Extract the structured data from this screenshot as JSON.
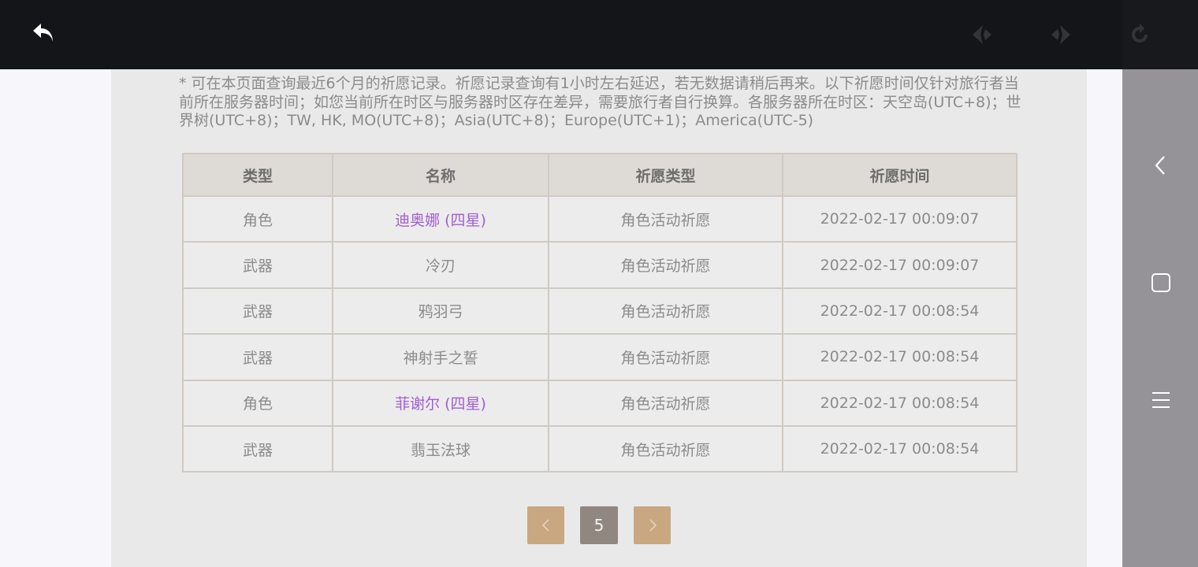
{
  "notice": "* 可在本页面查询最近6个月的祈愿记录。祈愿记录查询有1小时左右延迟，若无数据请稍后再来。以下祈愿时间仅针对旅行者当前所在服务器时间；如您当前所在时区与服务器时区存在差异，需要旅行者自行换算。各服务器所在时区：天空岛(UTC+8)；世界树(UTC+8)；TW, HK, MO(UTC+8)；Asia(UTC+8)；Europe(UTC+1)；America(UTC-5)",
  "table": {
    "headers": [
      "类型",
      "名称",
      "祈愿类型",
      "祈愿时间"
    ],
    "rows": [
      {
        "type": "角色",
        "name": "迪奥娜 (四星)",
        "wish_type": "角色活动祈愿",
        "time": "2022-02-17 00:09:07"
      },
      {
        "type": "武器",
        "name": "冷刃",
        "wish_type": "角色活动祈愿",
        "time": "2022-02-17 00:09:07"
      },
      {
        "type": "武器",
        "name": "鸦羽弓",
        "wish_type": "角色活动祈愿",
        "time": "2022-02-17 00:08:54"
      },
      {
        "type": "武器",
        "name": "神射手之誓",
        "wish_type": "角色活动祈愿",
        "time": "2022-02-17 00:08:54"
      },
      {
        "type": "角色",
        "name": "菲谢尔 (四星)",
        "wish_type": "角色活动祈愿",
        "time": "2022-02-17 00:08:54"
      },
      {
        "type": "武器",
        "name": "翡玉法球",
        "wish_type": "角色活动祈愿",
        "time": "2022-02-17 00:08:54"
      }
    ]
  },
  "pagination": {
    "current_page": "5"
  },
  "colors": {
    "rare_name": "#a25fd0",
    "pager_button": "#c8a781",
    "pager_current": "#8f8780",
    "topbar": "#141518"
  },
  "icons": {
    "topbar": [
      "back-arrow-icon",
      "nav-prev-icon",
      "nav-next-icon",
      "reload-icon"
    ],
    "sidenav": [
      "back-chevron-icon",
      "home-square-icon",
      "menu-icon"
    ]
  }
}
